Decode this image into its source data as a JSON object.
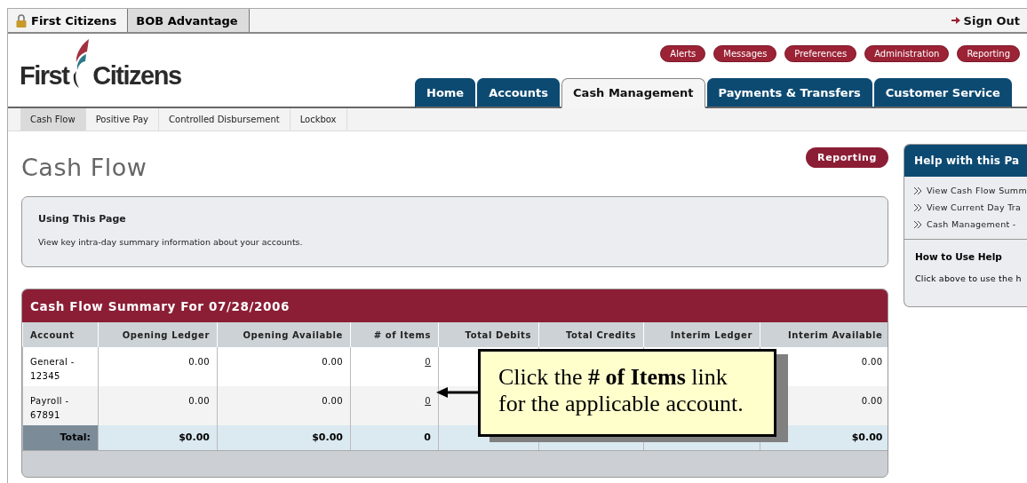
{
  "top_tabs": [
    {
      "label": "First Citizens",
      "kind": "lock",
      "selected": false
    },
    {
      "label": "BOB Advantage",
      "kind": "plain",
      "selected": true
    }
  ],
  "sign_out": "Sign Out",
  "logo_text": [
    "First",
    "Citizens"
  ],
  "utility_buttons": [
    "Alerts",
    "Messages",
    "Preferences",
    "Administration",
    "Reporting"
  ],
  "main_tabs": [
    {
      "label": "Home",
      "selected": false
    },
    {
      "label": "Accounts",
      "selected": false
    },
    {
      "label": "Cash Management",
      "selected": true
    },
    {
      "label": "Payments & Transfers",
      "selected": false
    },
    {
      "label": "Customer Service",
      "selected": false
    }
  ],
  "sub_tabs": [
    {
      "label": "Cash Flow",
      "selected": true
    },
    {
      "label": "Positive Pay",
      "selected": false
    },
    {
      "label": "Controlled Disbursement",
      "selected": false
    },
    {
      "label": "Lockbox",
      "selected": false
    }
  ],
  "page_title": "Cash Flow",
  "reporting_button": "Reporting",
  "info_box": {
    "title": "Using This Page",
    "text": "View key intra-day summary information about your accounts."
  },
  "table": {
    "title": "Cash Flow Summary For 07/28/2006",
    "columns": [
      {
        "label": "Account",
        "kind": "account"
      },
      {
        "label": "Opening Ledger",
        "kind": "amount"
      },
      {
        "label": "Opening Available",
        "kind": "amount"
      },
      {
        "label": "# of Items",
        "kind": "link"
      },
      {
        "label": "Total Debits",
        "kind": "amount"
      },
      {
        "label": "Total Credits",
        "kind": "amount"
      },
      {
        "label": "Interim Ledger",
        "kind": "amount"
      },
      {
        "label": "Interim Available",
        "kind": "amount"
      }
    ],
    "rows": [
      {
        "cells": [
          "General - 12345",
          "0.00",
          "0.00",
          "0",
          null,
          null,
          null,
          "0.00"
        ]
      },
      {
        "cells": [
          "Payroll - 67891",
          "0.00",
          "0.00",
          "0",
          null,
          null,
          null,
          "0.00"
        ]
      }
    ],
    "total": {
      "cells": [
        "Total:",
        "$0.00",
        "$0.00",
        "0",
        null,
        null,
        null,
        "$0.00"
      ]
    }
  },
  "callout": {
    "text": "Click the **# of Items** link for the applicable account."
  },
  "help_panel": {
    "title": "Help with this Pa",
    "links": [
      "View Cash Flow Summ",
      "View Current Day Tra",
      "Cash Management - "
    ],
    "how_title": "How to Use Help",
    "how_text": "Click above to use the h"
  }
}
